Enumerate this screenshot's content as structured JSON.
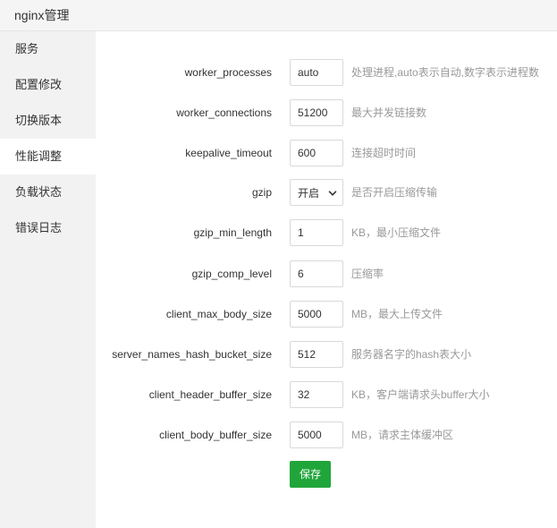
{
  "app": {
    "title": "nginx管理"
  },
  "sidebar": {
    "items": [
      {
        "label": "服务"
      },
      {
        "label": "配置修改"
      },
      {
        "label": "切换版本"
      },
      {
        "label": "性能调整"
      },
      {
        "label": "负载状态"
      },
      {
        "label": "错误日志"
      }
    ],
    "active_index": 3
  },
  "form": {
    "fields": [
      {
        "label": "worker_processes",
        "value": "auto",
        "hint": "处理进程,auto表示自动,数字表示进程数"
      },
      {
        "label": "worker_connections",
        "value": "51200",
        "hint": "最大并发链接数"
      },
      {
        "label": "keepalive_timeout",
        "value": "600",
        "hint": "连接超时时间"
      },
      {
        "label": "gzip",
        "value": "开启",
        "hint": "是否开启压缩传输",
        "type": "select"
      },
      {
        "label": "gzip_min_length",
        "value": "1",
        "hint": "KB，最小压缩文件"
      },
      {
        "label": "gzip_comp_level",
        "value": "6",
        "hint": "压缩率"
      },
      {
        "label": "client_max_body_size",
        "value": "5000",
        "hint": "MB，最大上传文件"
      },
      {
        "label": "server_names_hash_bucket_size",
        "value": "512",
        "hint": "服务器名字的hash表大小"
      },
      {
        "label": "client_header_buffer_size",
        "value": "32",
        "hint": "KB，客户端请求头buffer大小"
      },
      {
        "label": "client_body_buffer_size",
        "value": "5000",
        "hint": "MB，请求主体缓冲区"
      }
    ],
    "save_label": "保存"
  },
  "colors": {
    "primary": "#20a53a",
    "sidebar_bg": "#f2f2f2",
    "titlebar_bg": "#f5f5f5",
    "hint": "#999999"
  }
}
